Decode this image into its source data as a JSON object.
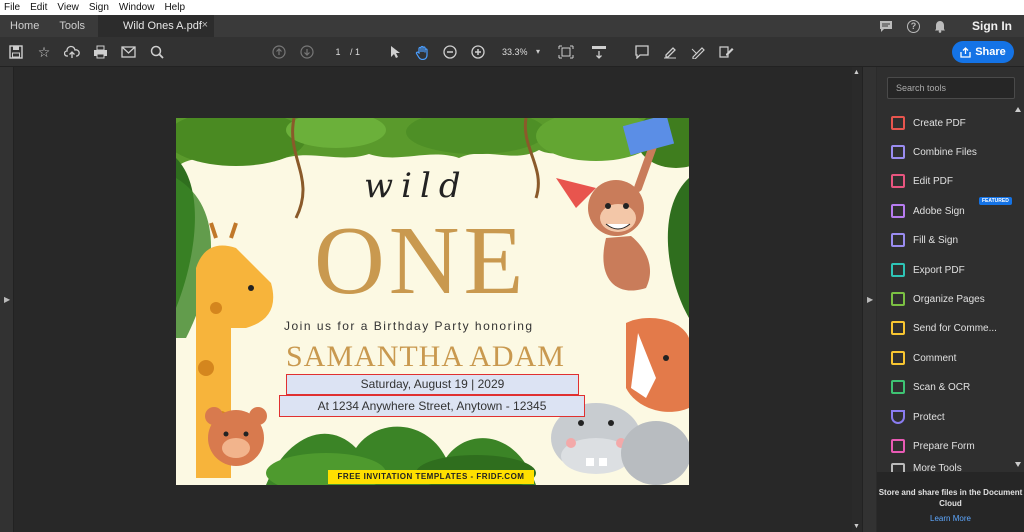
{
  "menubar": {
    "items": [
      "File",
      "Edit",
      "View",
      "Sign",
      "Window",
      "Help"
    ]
  },
  "tabs": {
    "home": "Home",
    "tools": "Tools",
    "document": "Wild Ones A.pdf",
    "close": "×"
  },
  "topright": {
    "sign_in": "Sign In"
  },
  "toolbar": {
    "page_current": "1",
    "page_total": "/ 1",
    "zoom": "33.3%",
    "share_label": "Share"
  },
  "panel": {
    "search_placeholder": "Search tools",
    "tools": [
      {
        "label": "Create PDF",
        "color": "#e8554e"
      },
      {
        "label": "Combine Files",
        "color": "#9a8cf0"
      },
      {
        "label": "Edit PDF",
        "color": "#e8557f"
      },
      {
        "label": "Adobe Sign",
        "color": "#b77cf0",
        "badge": "FEATURED"
      },
      {
        "label": "Fill & Sign",
        "color": "#9a8cf0"
      },
      {
        "label": "Export PDF",
        "color": "#2ec4b6"
      },
      {
        "label": "Organize Pages",
        "color": "#7bc043"
      },
      {
        "label": "Send for Comme...",
        "color": "#f7c531"
      },
      {
        "label": "Comment",
        "color": "#f7c531"
      },
      {
        "label": "Scan & OCR",
        "color": "#3ec373"
      },
      {
        "label": "Protect",
        "color": "#8a7cf0"
      },
      {
        "label": "Prepare Form",
        "color": "#e85ab4"
      },
      {
        "label": "More Tools",
        "color": "#bbbbbb"
      }
    ],
    "bottom_text": "Store and share files in the Document Cloud",
    "bottom_link": "Learn More"
  },
  "document": {
    "wild": "wild",
    "one": "ONE",
    "join": "Join us for a Birthday Party honoring",
    "name": "SAMANTHA ADAM",
    "date_field": "Saturday, August 19 | 2029",
    "address_field": "At 1234 Anywhere Street, Anytown - 12345",
    "footer": "FREE INVITATION TEMPLATES - FRIDF.COM"
  }
}
